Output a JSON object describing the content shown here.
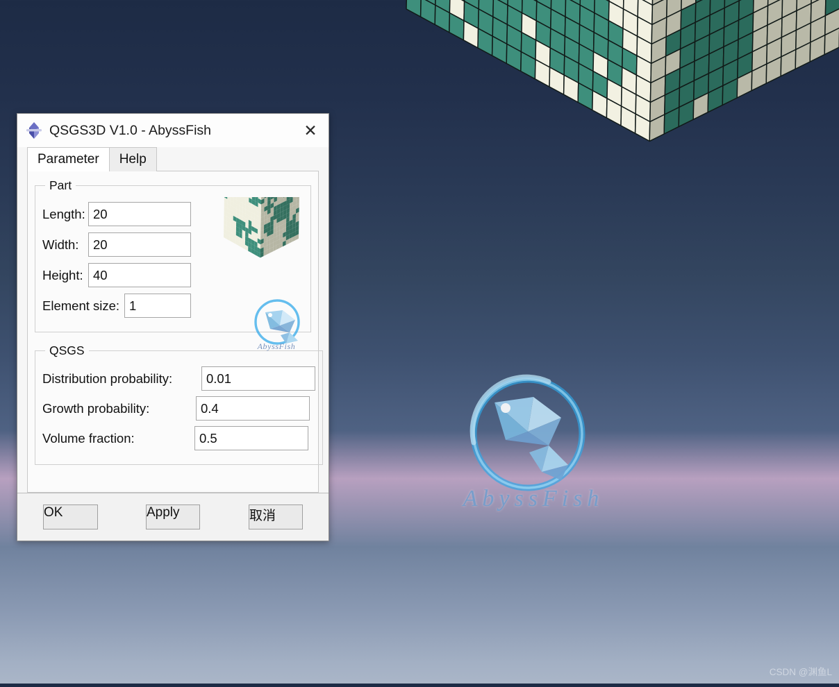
{
  "window": {
    "title": "QSGS3D V1.0 - AbyssFish",
    "icon": "octahedron-icon",
    "close_label": "✕"
  },
  "tabs": [
    {
      "label": "Parameter",
      "active": true
    },
    {
      "label": "Help",
      "active": false
    }
  ],
  "part_group": {
    "legend": "Part",
    "fields": [
      {
        "label": "Length:",
        "value": "20"
      },
      {
        "label": "Width:",
        "value": "20"
      },
      {
        "label": "Height:",
        "value": "40"
      },
      {
        "label": "Element size:",
        "value": "1"
      }
    ]
  },
  "qsgs_group": {
    "legend": "QSGS",
    "fields": [
      {
        "label": "Distribution probability:",
        "value": "0.01"
      },
      {
        "label": "Growth probability:",
        "value": "0.4"
      },
      {
        "label": "Volume fraction:",
        "value": "0.5"
      }
    ]
  },
  "footer": {
    "ok_label": "OK",
    "apply_label": "Apply",
    "cancel_label": "取消"
  },
  "preview": {
    "watermark_text": "AbyssFish",
    "logo_name": "abyssfish-fish-logo"
  },
  "viewport": {
    "watermark_text": "AbyssFish",
    "logo_name": "abyssfish-fish-logo"
  },
  "credit": "CSDN @渊鱼L",
  "colors": {
    "solid_front": "#3e8f7c",
    "pore_front": "#f2f1e2",
    "solid_side": "#2b6b5c",
    "pore_side": "#b9b9a8",
    "solid_top": "#47a08b",
    "pore_top": "#f5f4e7",
    "grid_line": "#111a18",
    "bg_top": "#1d2b45",
    "bg_bottom": "#aab6c8",
    "accent": "#6f9fd0"
  }
}
